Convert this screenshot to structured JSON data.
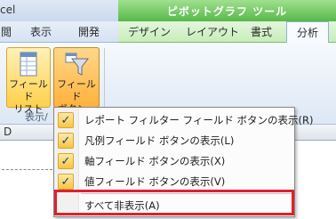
{
  "window": {
    "title_fragment": "cel"
  },
  "context_tab_group": {
    "title": "ピボットグラフ ツール"
  },
  "tabs": [
    {
      "label": "閲"
    },
    {
      "label": "表示"
    },
    {
      "label": "開発"
    },
    {
      "label": "デザイン"
    },
    {
      "label": "レイアウト"
    },
    {
      "label": "書式"
    },
    {
      "label": "分析"
    }
  ],
  "ribbon": {
    "field_list_button": {
      "label_line1": "フィールド",
      "label_line2": "リスト"
    },
    "field_button_button": {
      "label_line1": "フィールド",
      "label_line2": "ボタン"
    },
    "group_label": "表示/"
  },
  "sheet": {
    "column_header": "D"
  },
  "menu": {
    "items": [
      {
        "label": "レポート フィルター フィールド ボタンの表示(R)",
        "checked": true
      },
      {
        "label": "凡例フィールド ボタンの表示(L)",
        "checked": true
      },
      {
        "label": "軸フィールド ボタンの表示(X)",
        "checked": true
      },
      {
        "label": "値フィールド ボタンの表示(V)",
        "checked": true
      },
      {
        "label": "すべて非表示(A)",
        "checked": false
      }
    ]
  },
  "colors": {
    "context_accent": "#58b84a",
    "highlight_box": "#e0202e",
    "hover_button": "#ffd04a"
  }
}
